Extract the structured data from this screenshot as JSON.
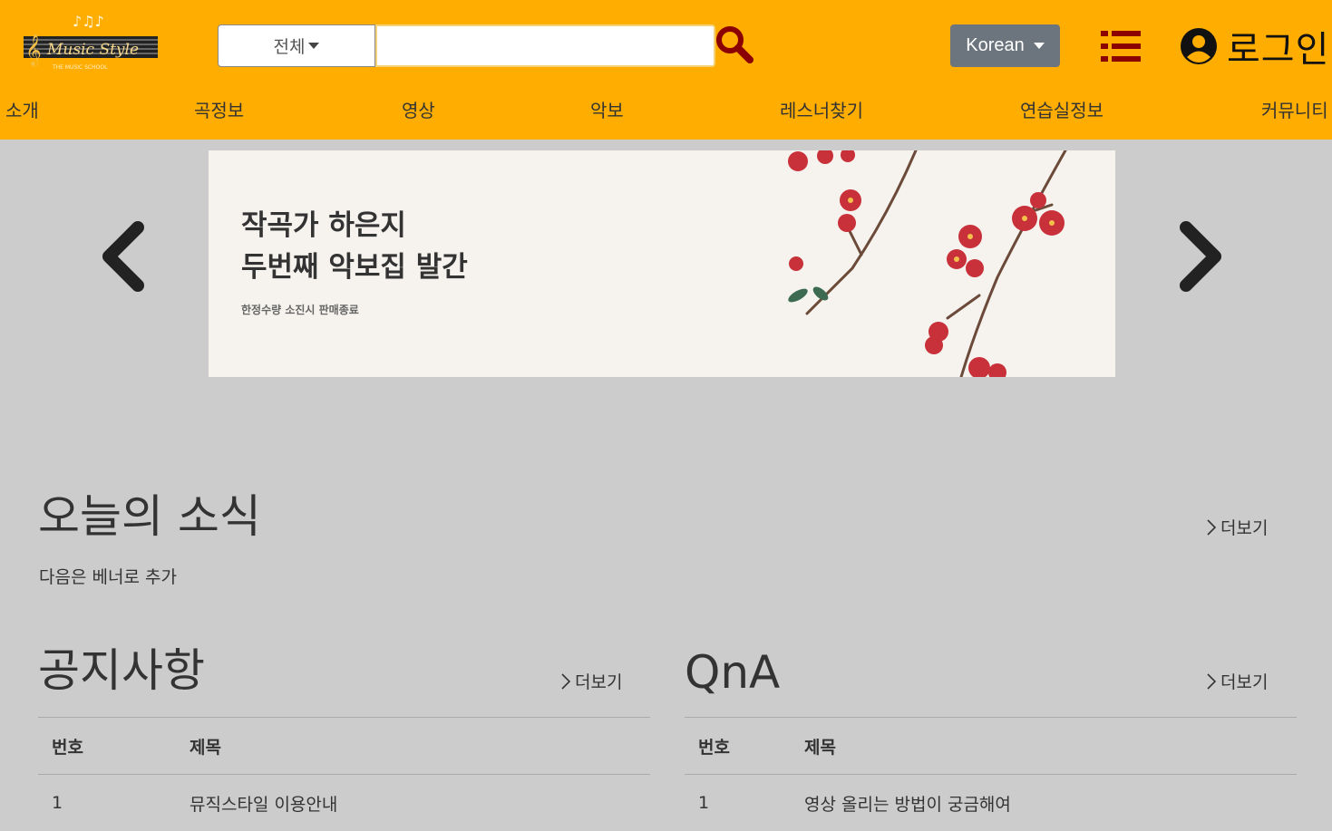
{
  "header": {
    "logo_text": "Music Style",
    "logo_subtext": "THE MUSIC SCHOOL",
    "search": {
      "category": "전체",
      "placeholder": "",
      "value": ""
    },
    "language": "Korean",
    "login": "로그인"
  },
  "nav": [
    "소개",
    "곡정보",
    "영상",
    "악보",
    "레스너찾기",
    "연습실정보",
    "커뮤니티"
  ],
  "banner": {
    "title": "작곡가 하은지\n두번째 악보집 발간",
    "subtitle": "한정수량 소진시 판매종료"
  },
  "today_news": {
    "title": "오늘의 소식",
    "more": "더보기",
    "text": "다음은 베너로 추가"
  },
  "notice": {
    "title": "공지사항",
    "more": "더보기",
    "columns": [
      "번호",
      "제목"
    ],
    "rows": [
      {
        "no": "1",
        "title": "뮤직스타일 이용안내"
      }
    ]
  },
  "qna": {
    "title": "QnA",
    "more": "더보기",
    "columns": [
      "번호",
      "제목"
    ],
    "rows": [
      {
        "no": "1",
        "title": "영상 올리는 방법이 궁금해여"
      }
    ]
  },
  "colors": {
    "header_bg": "#ffad00",
    "page_bg": "#cccccc",
    "icon_dark_red": "#8b0000",
    "lang_button": "#6c757d"
  }
}
